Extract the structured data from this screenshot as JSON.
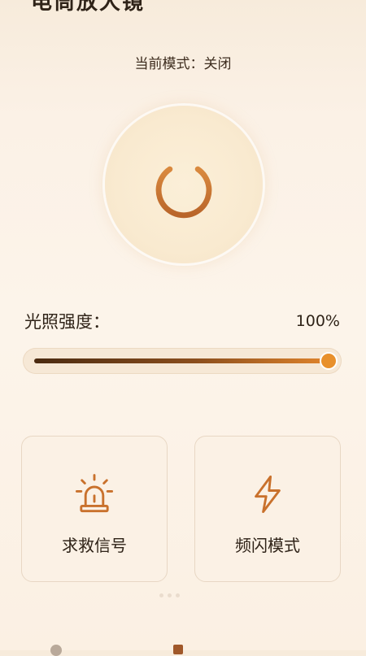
{
  "header": {
    "title": "电筒放大镜"
  },
  "status": {
    "mode_text": "当前模式：关闭"
  },
  "power": {
    "icon": "power-icon",
    "state": "off"
  },
  "light": {
    "label": "光照强度：",
    "value_text": "100%",
    "value": 1.0
  },
  "actions": [
    {
      "label": "求救信号",
      "icon": "siren-icon"
    },
    {
      "label": "频闪模式",
      "icon": "lightning-icon"
    }
  ],
  "colors": {
    "accent": "#c9712c",
    "thumb": "#e8902c",
    "text": "#2f2318"
  }
}
